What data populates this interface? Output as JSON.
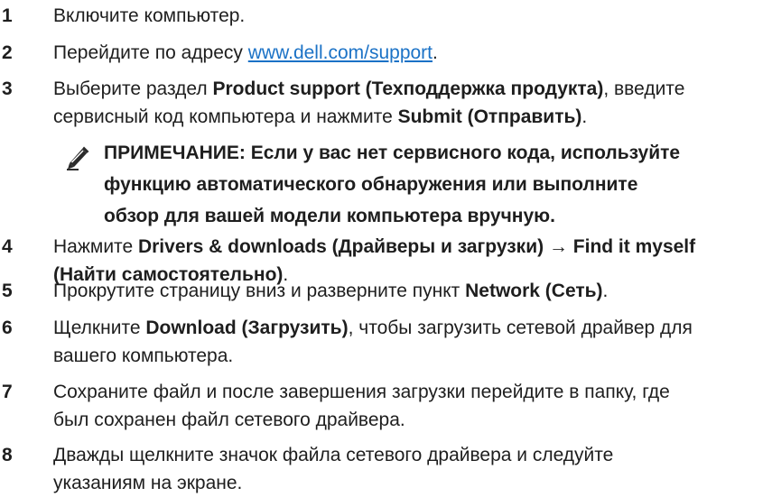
{
  "steps": [
    {
      "num": "1",
      "text": "Включите компьютер."
    },
    {
      "num": "2",
      "text_before": "Перейдите по адресу ",
      "link": "www.dell.com/support",
      "text_after": "."
    },
    {
      "num": "3",
      "line1_before": "Выберите раздел ",
      "line1_bold": "Product support (Техподдержка продукта)",
      "line1_after": ", введите",
      "line2_before": "сервисный код компьютера и нажмите ",
      "line2_bold": "Submit (Отправить)",
      "line2_after": "."
    },
    {
      "num": "4",
      "line1_before": "Нажмите ",
      "line1_bold1": "Drivers & downloads (Драйверы и загрузки)",
      "line1_arrow": " → ",
      "line1_bold2": "Find it myself",
      "line2_bold": "(Найти самостоятельно)",
      "line2_after": "."
    },
    {
      "num": "5",
      "text_before": "Прокрутите страницу вниз и разверните пункт ",
      "bold": "Network (Сеть)",
      "text_after": "."
    },
    {
      "num": "6",
      "line1_before": "Щелкните ",
      "line1_bold": "Download (Загрузить)",
      "line1_after": ", чтобы загрузить сетевой драйвер для",
      "line2": "вашего компьютера."
    },
    {
      "num": "7",
      "line1": "Сохраните файл и после завершения загрузки перейдите в папку, где",
      "line2": "был сохранен файл сетевого драйвера."
    },
    {
      "num": "8",
      "line1": "Дважды щелкните значок файла сетевого драйвера и следуйте",
      "line2": "указаниям на экране."
    }
  ],
  "note": {
    "icon": "pencil-note-icon",
    "line1": "ПРИМЕЧАНИЕ: Если у вас нет сервисного кода, используйте",
    "line2": "функцию автоматического обнаружения или выполните",
    "line3": "обзор для вашей модели компьютера вручную."
  },
  "colors": {
    "text": "#1e1e1e",
    "link": "#1b72c6"
  }
}
